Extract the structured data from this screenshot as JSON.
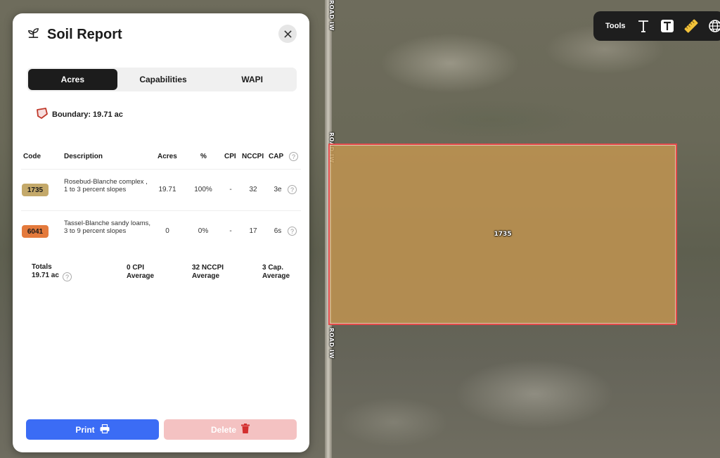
{
  "map": {
    "road_label_1": "ROAD IW",
    "road_label_2": "ROAD IW",
    "road_label_3": "ROAD IW",
    "parcel_label": "1735",
    "parcel_color": "#c4964f",
    "parcel_border_color": "#e44a4a"
  },
  "toolbar": {
    "label": "Tools",
    "icons": [
      "text-icon",
      "text-box-icon",
      "ruler-icon",
      "globe-icon"
    ]
  },
  "panel": {
    "title": "Soil Report",
    "tabs": [
      {
        "label": "Acres",
        "active": true
      },
      {
        "label": "Capabilities",
        "active": false
      },
      {
        "label": "WAPI",
        "active": false
      }
    ],
    "boundary_label": "Boundary: 19.71 ac",
    "columns": {
      "code": "Code",
      "description": "Description",
      "acres": "Acres",
      "percent": "%",
      "cpi": "CPI",
      "nccpi": "NCCPI",
      "cap": "CAP"
    },
    "rows": [
      {
        "code": "1735",
        "color": "#c4a96a",
        "description": "Rosebud-Blanche complex , 1 to 3 percent slopes",
        "acres": "19.71",
        "percent": "100%",
        "cpi": "-",
        "nccpi": "32",
        "cap": "3e"
      },
      {
        "code": "6041",
        "color": "#e47a3c",
        "description": "Tassel-Blanche sandy loams, 3 to 9 percent slopes",
        "acres": "0",
        "percent": "0%",
        "cpi": "-",
        "nccpi": "17",
        "cap": "6s"
      }
    ],
    "totals": {
      "label": "Totals",
      "acres": "19.71 ac",
      "cpi_value": "0 CPI",
      "cpi_caption": "Average",
      "nccpi_value": "32 NCCPI",
      "nccpi_caption": "Average",
      "cap_value": "3 Cap.",
      "cap_caption": "Average"
    },
    "print_label": "Print",
    "delete_label": "Delete",
    "print_color": "#3b6cf5",
    "delete_color": "#f4c2c2"
  }
}
